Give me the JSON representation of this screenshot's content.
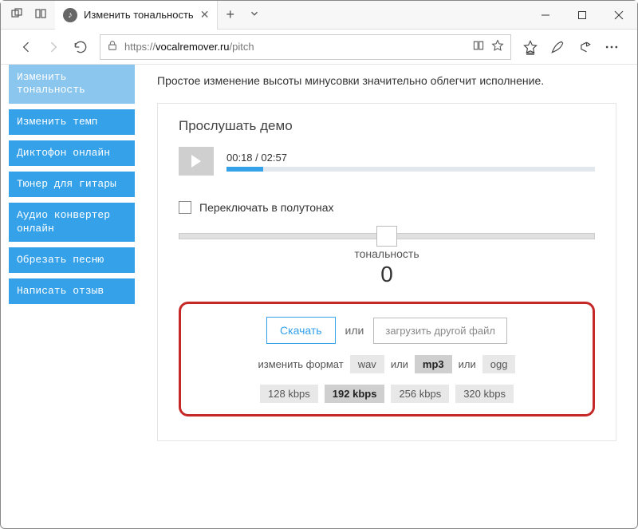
{
  "window": {
    "tab_title": "Изменить тональность"
  },
  "addressbar": {
    "scheme": "https://",
    "domain": "vocalremover.ru",
    "path": "/pitch"
  },
  "sidebar": {
    "items": [
      {
        "label": "Изменить тональность",
        "active": true
      },
      {
        "label": "Изменить темп"
      },
      {
        "label": "Диктофон онлайн"
      },
      {
        "label": "Тюнер для гитары"
      },
      {
        "label": "Аудио конвертер онлайн"
      },
      {
        "label": "Обрезать песню"
      },
      {
        "label": "Написать отзыв"
      }
    ]
  },
  "main": {
    "description": "Простое изменение высоты минусовки значительно облегчит исполнение.",
    "demo_heading": "Прослушать демо",
    "player": {
      "current": "00:18",
      "separator": " / ",
      "total": "02:57",
      "progress_percent": 10
    },
    "semitone_checkbox_label": "Переключать в полутонах",
    "semitone_checked": false,
    "slider": {
      "label": "тональность",
      "value": "0",
      "position_percent": 50
    }
  },
  "download": {
    "download_label": "Скачать",
    "or": "или",
    "upload_label": "загрузить другой файл",
    "format_prefix": "изменить формат",
    "formats": [
      "wav",
      "mp3",
      "ogg"
    ],
    "format_selected": "mp3",
    "format_or": "или",
    "bitrates": [
      "128 kbps",
      "192 kbps",
      "256 kbps",
      "320 kbps"
    ],
    "bitrate_selected": "192 kbps"
  }
}
